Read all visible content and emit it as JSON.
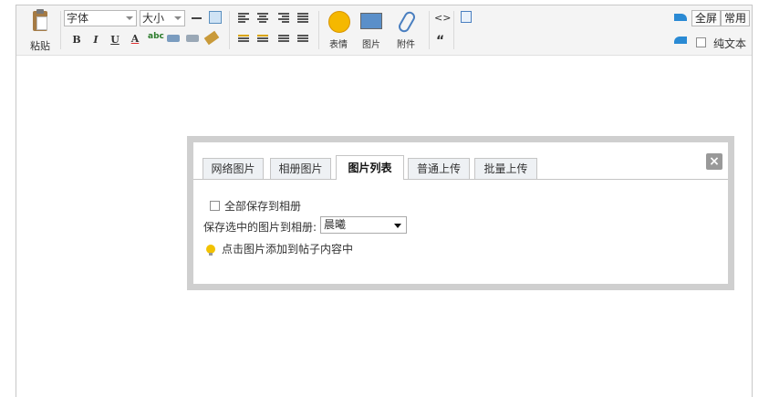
{
  "toolbar": {
    "paste_label": "粘贴",
    "font_family": "字体",
    "font_size": "大小",
    "bold": "B",
    "italic": "I",
    "underline": "U",
    "font_color": "A",
    "emoticon_label": "表情",
    "image_label": "图片",
    "attachment_label": "附件",
    "code_glyph": "<>",
    "quote_glyph": "“",
    "fullscreen": "全屏",
    "common": "常用",
    "plain_text": "纯文本",
    "accent_color": "#2a8ad4"
  },
  "dialog": {
    "tabs": [
      {
        "label": "网络图片"
      },
      {
        "label": "相册图片"
      },
      {
        "label": "图片列表"
      },
      {
        "label": "普通上传"
      },
      {
        "label": "批量上传"
      }
    ],
    "active_tab": "图片列表",
    "close_glyph": "×",
    "save_all_label": "全部保存到相册",
    "save_selected_label": "保存选中的图片到相册:",
    "album_selected": "晨曦",
    "hint": "点击图片添加到帖子内容中"
  }
}
